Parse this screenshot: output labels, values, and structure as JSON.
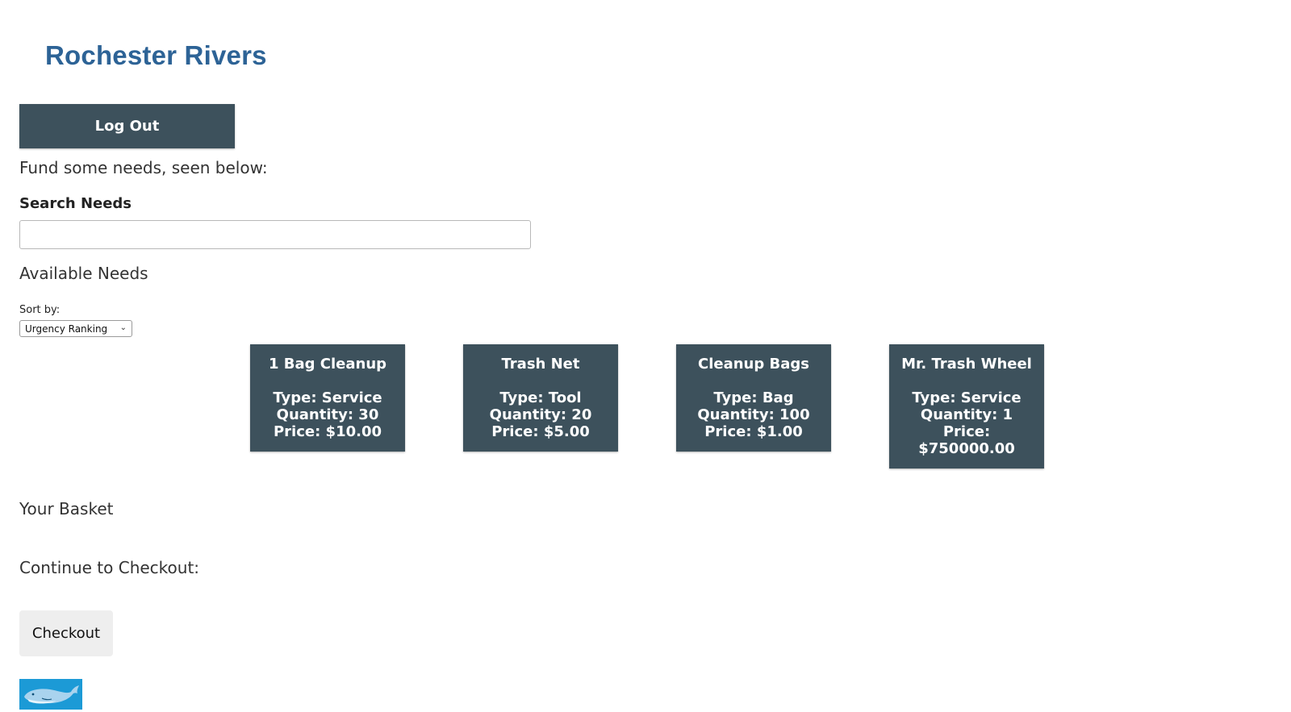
{
  "header": {
    "title": "Rochester Rivers",
    "logout_label": "Log Out"
  },
  "intro": "Fund some needs, seen below:",
  "search": {
    "label": "Search Needs",
    "value": "",
    "placeholder": ""
  },
  "available": {
    "heading": "Available Needs",
    "sort_label": "Sort by:",
    "sort_selected": "Urgency Ranking"
  },
  "needs": [
    {
      "name": "1 Bag Cleanup",
      "type": "Type: Service",
      "quantity": "Quantity: 30",
      "price": "Price: $10.00"
    },
    {
      "name": "Trash Net",
      "type": "Type: Tool",
      "quantity": "Quantity: 20",
      "price": "Price: $5.00"
    },
    {
      "name": "Cleanup Bags",
      "type": "Type: Bag",
      "quantity": "Quantity: 100",
      "price": "Price: $1.00"
    },
    {
      "name": "Mr. Trash Wheel",
      "type": "Type: Service",
      "quantity": "Quantity: 1",
      "price": "Price:",
      "price_value": "$750000.00"
    }
  ],
  "basket": {
    "heading": "Your Basket"
  },
  "checkout": {
    "prompt": "Continue to Checkout:",
    "button_label": "Checkout"
  },
  "footer": {
    "logo_icon": "whale-icon"
  },
  "colors": {
    "title": "#2d6396",
    "card_bg": "#3d515c",
    "logo_bg": "#1c9ad6"
  }
}
